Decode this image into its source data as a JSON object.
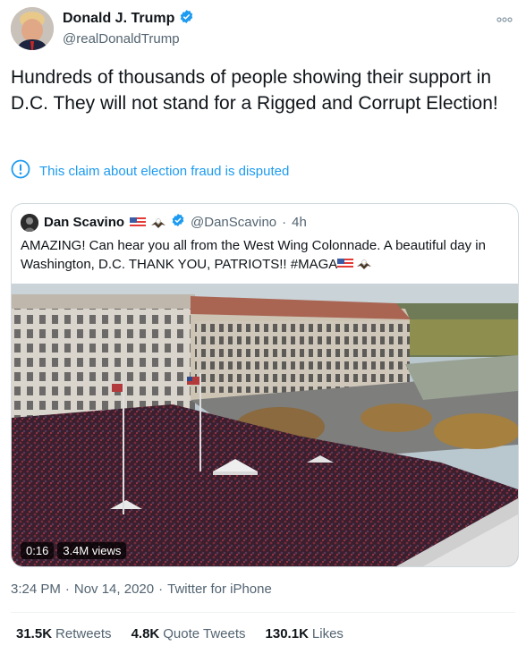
{
  "author": {
    "name": "Donald J. Trump",
    "handle": "@realDonaldTrump",
    "verified": true
  },
  "tweet": {
    "text": "Hundreds of thousands of people showing their support in D.C. They will not stand for a Rigged and Corrupt Election!",
    "notice": "This claim about election fraud is disputed"
  },
  "quoted": {
    "name": "Dan Scavino",
    "handle": "@DanScavino",
    "separator": "·",
    "time": "4h",
    "text": "AMAZING! Can hear you all from the West Wing Colonnade. A beautiful day in Washington, D.C. THANK YOU, PATRIOTS!! #MAGA",
    "video_duration": "0:16",
    "video_views": "3.4M views"
  },
  "meta": {
    "time": "3:24 PM",
    "dot1": "·",
    "date": "Nov 14, 2020",
    "dot2": "·",
    "source": "Twitter for iPhone"
  },
  "stats": {
    "retweets_num": "31.5K",
    "retweets_label": "Retweets",
    "quotes_num": "4.8K",
    "quotes_label": "Quote Tweets",
    "likes_num": "130.1K",
    "likes_label": "Likes"
  },
  "colors": {
    "accent": "#1d9bf0",
    "secondary_text": "#536471",
    "border": "#cfd9de"
  },
  "icons": {
    "verified": "verified-badge-icon",
    "more": "more-options-icon",
    "notice": "exclamation-circle-icon",
    "flag": "us-flag-icon",
    "eagle": "eagle-icon"
  }
}
